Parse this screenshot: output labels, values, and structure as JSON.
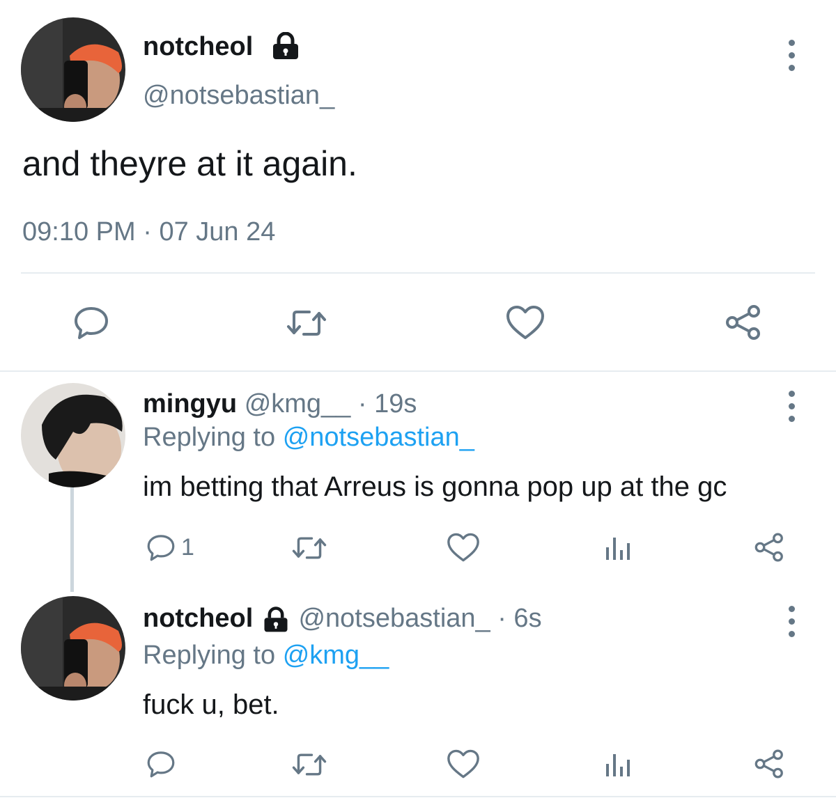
{
  "main_tweet": {
    "display_name": "notcheol",
    "handle": "@notsebastian_",
    "text": "and theyre at it again.",
    "time": "09:10 PM",
    "separator": "·",
    "date": "07 Jun 24"
  },
  "replies": [
    {
      "display_name": "mingyu",
      "handle": "@kmg__",
      "age": "· 19s",
      "replying_prefix": "Replying to",
      "replying_to": "@notsebastian_",
      "text": "im betting that Arreus is gonna pop up at the gc",
      "reply_count": "1"
    },
    {
      "display_name": "notcheol",
      "handle": "@notsebastian_",
      "age": "· 6s",
      "replying_prefix": "Replying to",
      "replying_to": "@kmg__",
      "text": "fuck u, bet."
    }
  ],
  "colors": {
    "icon_gray": "#657786",
    "link_blue": "#1da1f2",
    "divider": "#e6ecf0",
    "thread_line": "#ccd6dd"
  },
  "icons": [
    "lock-icon",
    "more-icon",
    "reply-icon",
    "retweet-icon",
    "like-icon",
    "share-icon",
    "analytics-icon"
  ]
}
